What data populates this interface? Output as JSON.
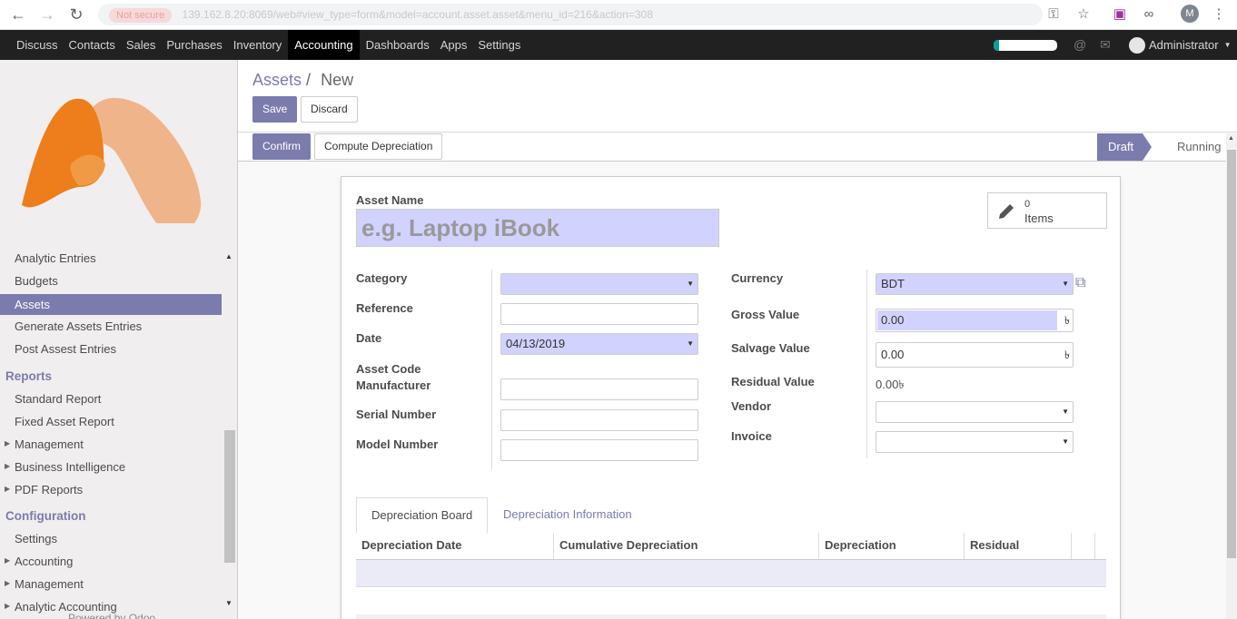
{
  "browser": {
    "url_site": "Not secure",
    "url_text": "139.162.8.20:8069/web#view_type=form&model=account.asset.asset&menu_id=216&action=308",
    "profile_initial": "M"
  },
  "topnav": {
    "items": [
      "Discuss",
      "Contacts",
      "Sales",
      "Purchases",
      "Inventory",
      "Accounting",
      "Dashboards",
      "Apps",
      "Settings"
    ],
    "active": "Accounting",
    "progress_fraction": 0.08,
    "user": "Administrator"
  },
  "sidebar": {
    "items": {
      "analytic_entries": "Analytic Entries",
      "budgets": "Budgets",
      "assets": "Assets",
      "generate_assets": "Generate Assets Entries",
      "post_assest": "Post Assest Entries",
      "reports_header": "Reports",
      "standard_report": "Standard Report",
      "fixed_asset_report": "Fixed Asset Report",
      "management": "Management",
      "business_intelligence": "Business Intelligence",
      "pdf_reports": "PDF Reports",
      "configuration_header": "Configuration",
      "settings": "Settings",
      "accounting": "Accounting",
      "management2": "Management",
      "analytic_accounting": "Analytic Accounting"
    },
    "powered_by": "Powered by Odoo",
    "colors": {
      "logo_dark": "#ee7d1b",
      "logo_light": "#f0b48a",
      "accent": "#7c7bad"
    }
  },
  "breadcrumb": {
    "parent": "Assets",
    "separator": "/",
    "current": "New"
  },
  "buttons": {
    "save": "Save",
    "discard": "Discard",
    "confirm": "Confirm",
    "compute": "Compute Depreciation"
  },
  "status": {
    "draft": "Draft",
    "running": "Running"
  },
  "form": {
    "asset_name_label": "Asset Name",
    "asset_name_placeholder": "e.g. Laptop iBook",
    "smart_button": {
      "count": "0",
      "label": "Items"
    },
    "left": {
      "category": "Category",
      "reference": "Reference",
      "date": "Date",
      "date_value": "04/13/2019",
      "asset_code_manufacturer": "Asset Code Manufacturer",
      "serial_number": "Serial Number",
      "model_number": "Model Number"
    },
    "right": {
      "currency": "Currency",
      "currency_value": "BDT",
      "gross_value": "Gross Value",
      "gross_value_value": "0.00",
      "salvage_value": "Salvage Value",
      "salvage_value_value": "0.00",
      "residual_value": "Residual Value",
      "residual_value_value": "0.00৳",
      "vendor": "Vendor",
      "invoice": "Invoice",
      "currency_symbol": "৳"
    }
  },
  "tabs": {
    "board": "Depreciation Board",
    "information": "Depreciation Information"
  },
  "table": {
    "headers": [
      "Depreciation Date",
      "Cumulative Depreciation",
      "Depreciation",
      "Residual"
    ]
  }
}
